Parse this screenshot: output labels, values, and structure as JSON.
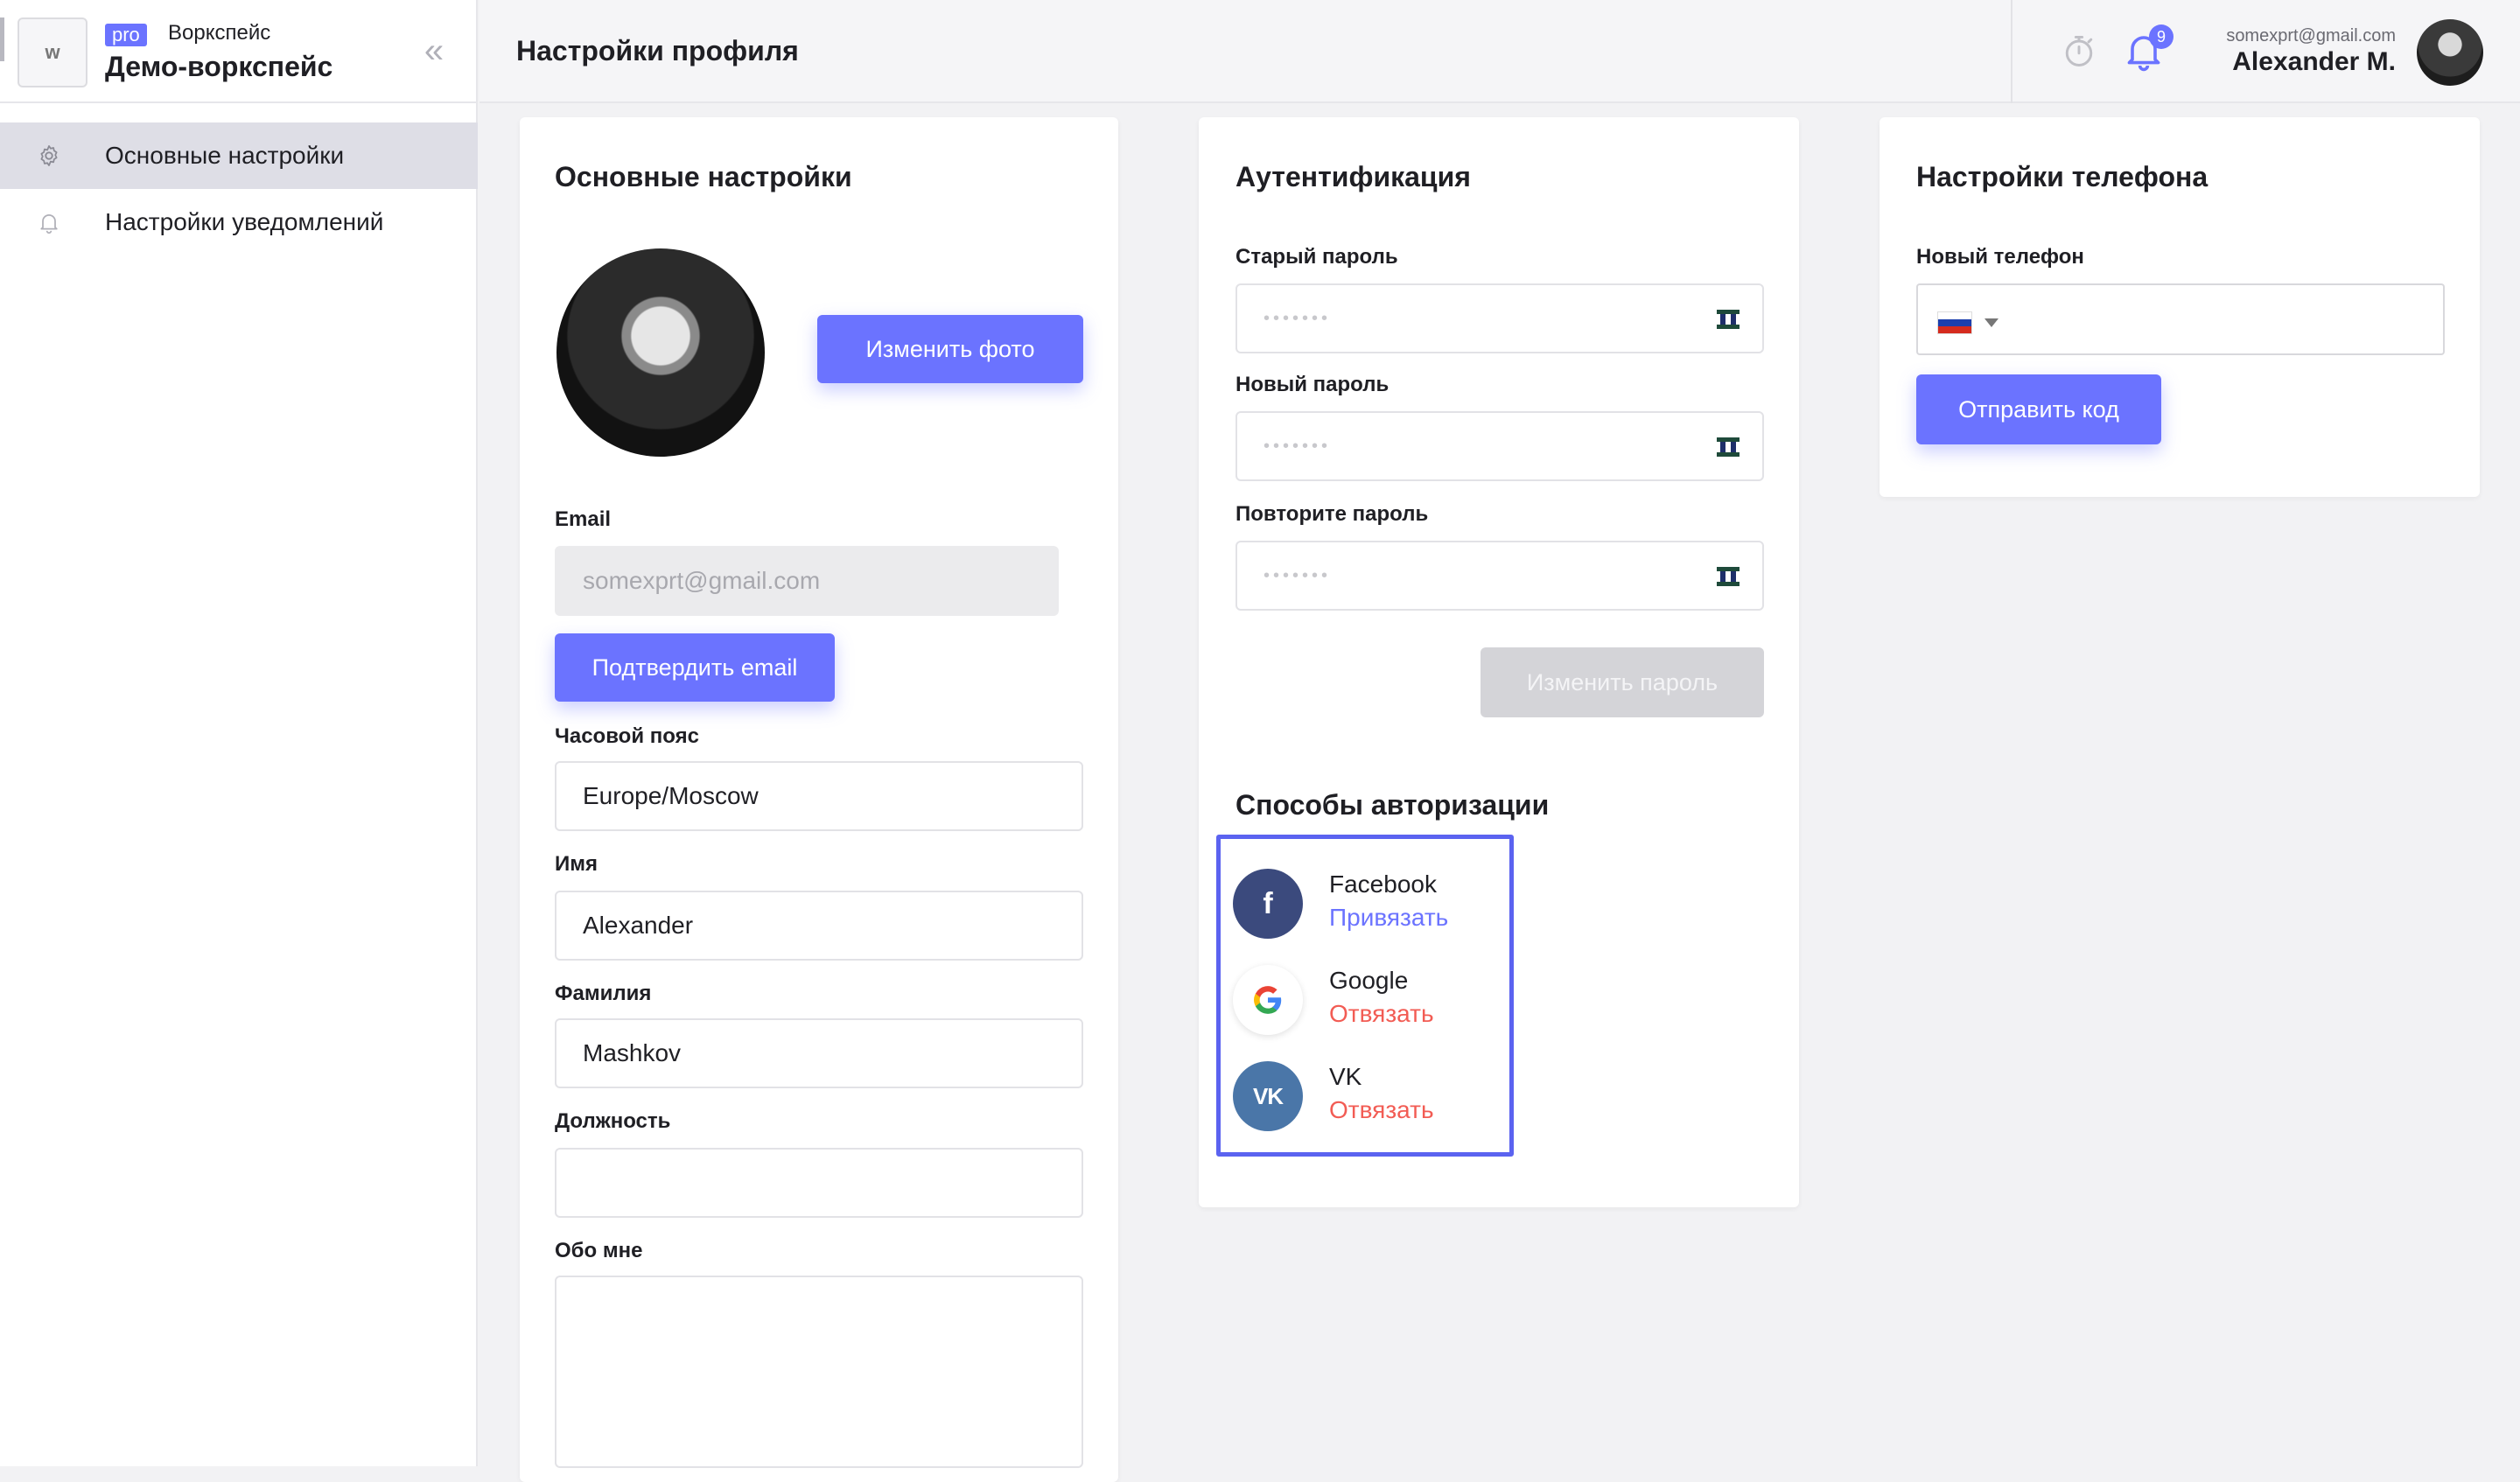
{
  "workspace": {
    "logo_letter": "w",
    "badge": "pro",
    "subtitle": "Воркспейс",
    "name": "Демо-воркспейс"
  },
  "sidebar": {
    "collapse_glyph": "«",
    "items": [
      {
        "label": "Основные настройки",
        "icon": "gear-icon",
        "active": true
      },
      {
        "label": "Настройки уведомлений",
        "icon": "bell-icon",
        "active": false
      }
    ]
  },
  "header": {
    "title": "Настройки профиля",
    "notifications_count": "9",
    "user_email": "somexprt@gmail.com",
    "user_name": "Alexander M."
  },
  "basic": {
    "title": "Основные настройки",
    "change_photo": "Изменить фото",
    "email_label": "Email",
    "email_value": "somexprt@gmail.com",
    "confirm_email": "Подтвердить email",
    "timezone_label": "Часовой пояс",
    "timezone_value": "Europe/Moscow",
    "first_name_label": "Имя",
    "first_name_value": "Alexander",
    "last_name_label": "Фамилия",
    "last_name_value": "Mashkov",
    "position_label": "Должность",
    "position_value": "",
    "about_label": "Обо мне",
    "about_value": ""
  },
  "auth": {
    "title": "Аутентификация",
    "old_password_label": "Старый пароль",
    "new_password_label": "Новый пароль",
    "repeat_password_label": "Повторите пароль",
    "password_mask": "•••••••",
    "change_password": "Изменить пароль",
    "methods_title": "Способы авторизации",
    "methods": [
      {
        "name": "Facebook",
        "action": "Привязать",
        "action_color": "#6b73ff",
        "icon": "facebook-icon"
      },
      {
        "name": "Google",
        "action": "Отвязать",
        "action_color": "#f25c54",
        "icon": "google-icon"
      },
      {
        "name": "VK",
        "action": "Отвязать",
        "action_color": "#f25c54",
        "icon": "vk-icon"
      }
    ]
  },
  "phone": {
    "title": "Настройки телефона",
    "new_phone_label": "Новый телефон",
    "country": "ru-flag-icon",
    "send_code": "Отправить код"
  },
  "colors": {
    "accent": "#6b73ff",
    "danger": "#f25c54",
    "highlight_border": "#5b63f0"
  }
}
